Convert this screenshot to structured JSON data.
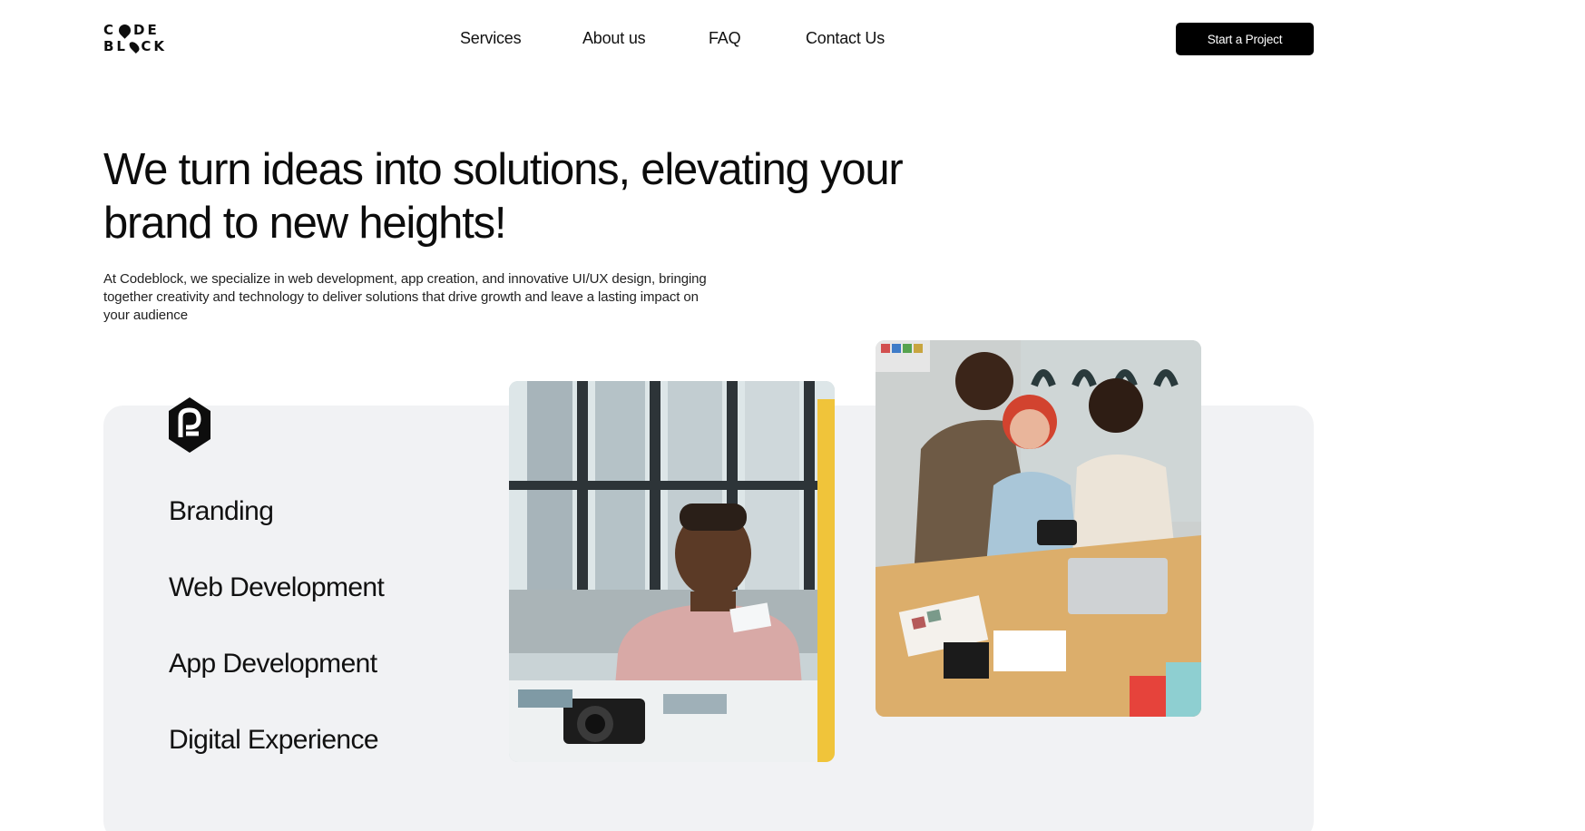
{
  "brand": {
    "line1_a": "C",
    "line1_b": "DE",
    "line2_a": "BL",
    "line2_b": "CK"
  },
  "nav": {
    "items": [
      "Services",
      "About us",
      "FAQ",
      "Contact Us"
    ]
  },
  "cta": {
    "label": "Start a Project"
  },
  "hero": {
    "title": "We turn ideas into solutions, elevating your brand to new heights!",
    "description": "At Codeblock, we specialize in web development, app creation, and innovative UI/UX design, bringing together creativity and technology to deliver solutions that drive growth and leave a lasting impact on your audience"
  },
  "services": {
    "items": [
      "Branding",
      "Web Development",
      "App Development",
      "Digital Experience"
    ]
  },
  "colors": {
    "accent": "#000000",
    "panel": "#f1f2f4",
    "text": "#0d0d0d"
  },
  "icons": {
    "panel_icon": "codeblock-mark-icon"
  }
}
